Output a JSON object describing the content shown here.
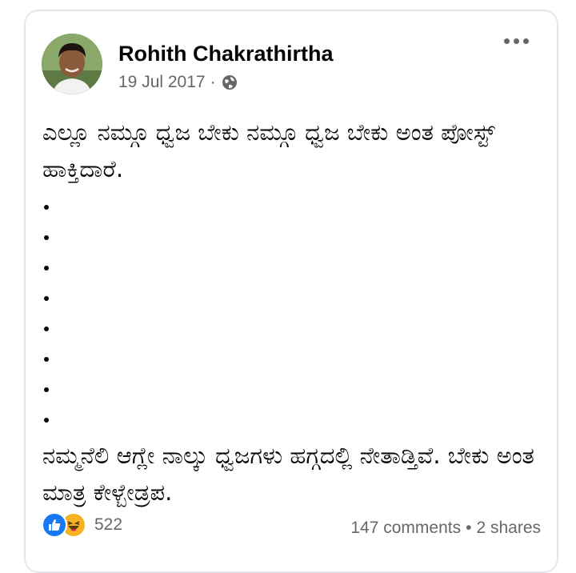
{
  "post": {
    "author": "Rohith Chakrathirtha",
    "date": "19 Jul 2017",
    "separator": "·",
    "privacy_icon": "globe-icon",
    "menu_icon": "more-options-icon",
    "text_top": "ಎಲ್ಲೂ ನಮ್ಗೂ ಧ್ವಜ ಬೇಕು ನಮ್ಗೂ ಧ್ವಜ ಬೇಕು ಅಂತ ಪೋಸ್ಟ್ ಹಾಕ್ತಿದಾರೆ.",
    "text_bottom": "ನಮ್ಮನೆಲಿ ಆಗ್ಲೇ ನಾಲ್ಕು ಧ್ವಜಗಳು ಹಗ್ಗದಲ್ಲಿ ನೇತಾಡ್ತಿವೆ. ಬೇಕು ಅಂತ ಮಾತ್ರ ಕೇಳ್ಬೇಡ್ರಪ."
  },
  "footer": {
    "reaction_icons": [
      "like-icon",
      "haha-icon"
    ],
    "reaction_count": "522",
    "comments": "147 comments",
    "separator": "•",
    "shares": "2 shares"
  },
  "colors": {
    "like": "#1877f2",
    "haha": "#f7b125",
    "secondary_text": "#65676b",
    "primary_text": "#050505"
  }
}
